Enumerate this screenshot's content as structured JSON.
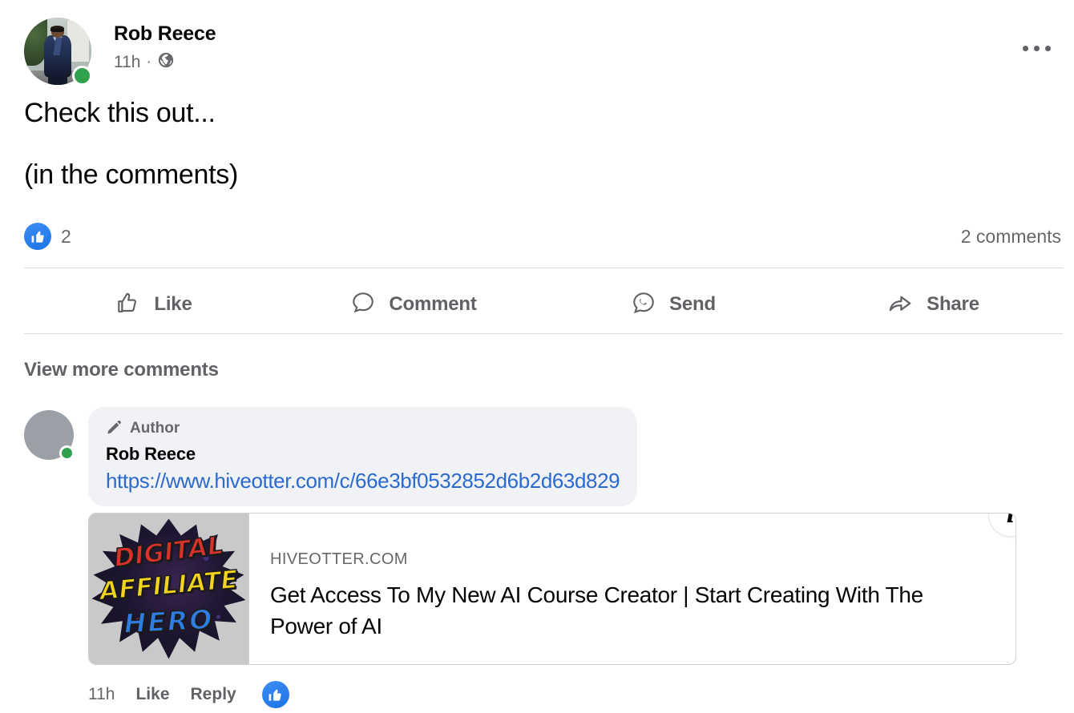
{
  "post": {
    "author": "Rob Reece",
    "timestamp": "11h",
    "separator": "·",
    "audience_icon": "globe-icon",
    "menu_icon": "more-options-icon",
    "body_lines": [
      "Check this out...",
      "(in the comments)"
    ],
    "reaction_count": "2",
    "comments_count": "2 comments",
    "actions": [
      {
        "label": "Like",
        "icon": "thumbs-up-outline-icon"
      },
      {
        "label": "Comment",
        "icon": "comment-bubble-icon"
      },
      {
        "label": "Send",
        "icon": "send-messenger-icon"
      },
      {
        "label": "Share",
        "icon": "share-arrow-icon"
      }
    ],
    "view_more_comments": "View more comments"
  },
  "comment": {
    "author_badge": "Author",
    "author_badge_icon": "pencil-icon",
    "name": "Rob Reece",
    "link_text": "https://www.hiveotter.com/c/66e3bf0532852d6b2d63d829",
    "footer": {
      "time": "11h",
      "like": "Like",
      "reply": "Reply",
      "reaction_icon": "like-reaction-badge"
    }
  },
  "link_preview": {
    "domain": "HIVEOTTER.COM",
    "title": "Get Access To My New AI Course Creator | Start Creating With The Power of AI",
    "thumbnail": {
      "line1": "DIGITAL",
      "line2": "AFFILIATE",
      "line3": "HERO"
    },
    "info_icon": "info-icon",
    "info_glyph": "i"
  },
  "colors": {
    "link_blue": "#2b6ad0",
    "reaction_blue": "#1b74e4",
    "online_green": "#31a24c",
    "text_primary": "#050505",
    "text_secondary": "#65676b",
    "bubble_bg": "#f0f2f5"
  }
}
